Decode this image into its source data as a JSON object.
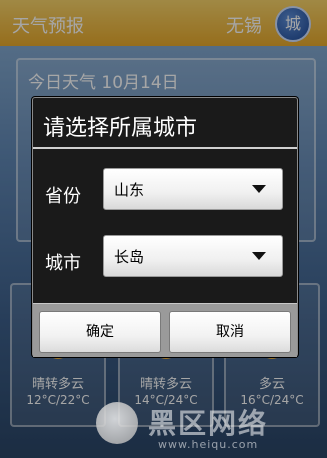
{
  "app": {
    "title": "天气预报",
    "city": "无锡",
    "city_button": "城",
    "today_title": "今日天气  10月14日"
  },
  "forecast": [
    {
      "condition": "晴转多云",
      "temp": "12°C/22°C"
    },
    {
      "condition": "晴转多云",
      "temp": "14°C/24°C"
    },
    {
      "condition": "多云",
      "temp": "16°C/24°C"
    }
  ],
  "dialog": {
    "title": "请选择所属城市",
    "province_label": "省份",
    "province_value": "山东",
    "city_label": "城市",
    "city_value": "长岛",
    "ok_label": "确定",
    "cancel_label": "取消"
  },
  "watermark": {
    "text": "黑区网络",
    "url": "www.heiqu.com"
  }
}
